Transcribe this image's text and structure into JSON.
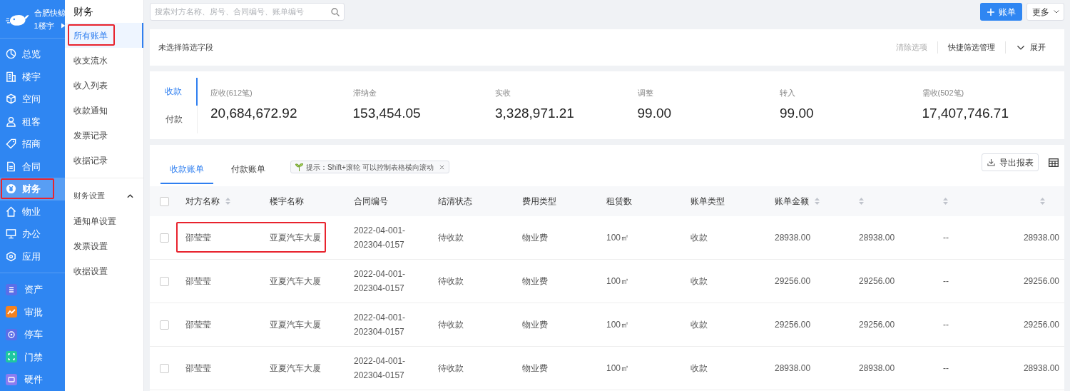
{
  "brand": {
    "company": "合肥快鲸",
    "building": "1楼宇"
  },
  "nav": {
    "items": [
      {
        "label": "总览",
        "selected": false,
        "highlighted": false
      },
      {
        "label": "楼宇",
        "selected": false,
        "highlighted": false
      },
      {
        "label": "空间",
        "selected": false,
        "highlighted": false
      },
      {
        "label": "租客",
        "selected": false,
        "highlighted": false
      },
      {
        "label": "招商",
        "selected": false,
        "highlighted": false
      },
      {
        "label": "合同",
        "selected": false,
        "highlighted": false
      },
      {
        "label": "财务",
        "selected": true,
        "highlighted": true
      },
      {
        "label": "物业",
        "selected": false,
        "highlighted": false
      },
      {
        "label": "办公",
        "selected": false,
        "highlighted": false
      },
      {
        "label": "应用",
        "selected": false,
        "highlighted": false
      }
    ]
  },
  "apps": [
    {
      "label": "资产",
      "color": "#5b6ee8"
    },
    {
      "label": "审批",
      "color": "#f5821f"
    },
    {
      "label": "停车",
      "color": "#5b6ee8"
    },
    {
      "label": "门禁",
      "color": "#1fc7a0"
    },
    {
      "label": "硬件",
      "color": "#8c7cf0"
    }
  ],
  "submenu": {
    "title": "财务",
    "items": [
      {
        "label": "所有账单",
        "selected": true,
        "highlighted": true
      },
      {
        "label": "收支流水",
        "selected": false,
        "highlighted": false
      },
      {
        "label": "收入列表",
        "selected": false,
        "highlighted": false
      },
      {
        "label": "收款通知",
        "selected": false,
        "highlighted": false
      },
      {
        "label": "发票记录",
        "selected": false,
        "highlighted": false
      },
      {
        "label": "收据记录",
        "selected": false,
        "highlighted": false
      }
    ],
    "group": {
      "label": "财务设置",
      "expanded": true,
      "items": [
        {
          "label": "通知单设置"
        },
        {
          "label": "发票设置"
        },
        {
          "label": "收据设置"
        }
      ]
    }
  },
  "toolbar": {
    "search_placeholder": "搜索对方名称、房号、合同编号、账单编号",
    "add_button": "账单",
    "more_button": "更多"
  },
  "filter": {
    "status": "未选择筛选字段",
    "clear": "清除选项",
    "manage": "快捷筛选管理",
    "expand": "展开"
  },
  "summary": {
    "tabs": [
      {
        "label": "收款",
        "selected": true
      },
      {
        "label": "付款",
        "selected": false
      }
    ],
    "stats": [
      {
        "label": "应收(612笔)",
        "value": "20,684,672.92"
      },
      {
        "label": "滞纳金",
        "value": "153,454.05"
      },
      {
        "label": "实收",
        "value": "3,328,971.21"
      },
      {
        "label": "调整",
        "value": "99.00"
      },
      {
        "label": "转入",
        "value": "99.00"
      },
      {
        "label": "需收(502笔)",
        "value": "17,407,746.71"
      }
    ]
  },
  "bills": {
    "tabs": [
      {
        "label": "收款账单",
        "selected": true
      },
      {
        "label": "付款账单",
        "selected": false
      }
    ],
    "hint": "提示：Shift+滚轮 可以控制表格横向滚动",
    "export_button": "导出报表"
  },
  "table": {
    "columns": [
      {
        "label": "对方名称",
        "sortable": true
      },
      {
        "label": "楼宇名称",
        "sortable": false
      },
      {
        "label": "合同编号",
        "sortable": false
      },
      {
        "label": "结清状态",
        "sortable": false
      },
      {
        "label": "费用类型",
        "sortable": false
      },
      {
        "label": "租赁数",
        "sortable": false
      },
      {
        "label": "账单类型",
        "sortable": false
      },
      {
        "label": "账单金额",
        "sortable": true
      },
      {
        "sortable": true
      },
      {
        "sortable": true
      },
      {
        "sortable": true
      }
    ],
    "all_checked": false,
    "rows": [
      {
        "checked": false,
        "highlighted": true,
        "cells": [
          "邵莹莹",
          "亚夏汽车大厦",
          "2022-04-001-202304-0157",
          "待收款",
          "物业费",
          "100㎡",
          "收款",
          "28938.00",
          "28938.00",
          "--",
          "28938.00"
        ]
      },
      {
        "checked": false,
        "cells": [
          "邵莹莹",
          "亚夏汽车大厦",
          "2022-04-001-202304-0157",
          "待收款",
          "物业费",
          "100㎡",
          "收款",
          "29256.00",
          "29256.00",
          "--",
          "29256.00"
        ]
      },
      {
        "checked": false,
        "cells": [
          "邵莹莹",
          "亚夏汽车大厦",
          "2022-04-001-202304-0157",
          "待收款",
          "物业费",
          "100㎡",
          "收款",
          "29256.00",
          "29256.00",
          "--",
          "29256.00"
        ]
      },
      {
        "checked": false,
        "cells": [
          "邵莹莹",
          "亚夏汽车大厦",
          "2022-04-001-202304-0157",
          "待收款",
          "物业费",
          "100㎡",
          "收款",
          "28938.00",
          "28938.00",
          "--",
          "28938.00"
        ]
      }
    ]
  }
}
